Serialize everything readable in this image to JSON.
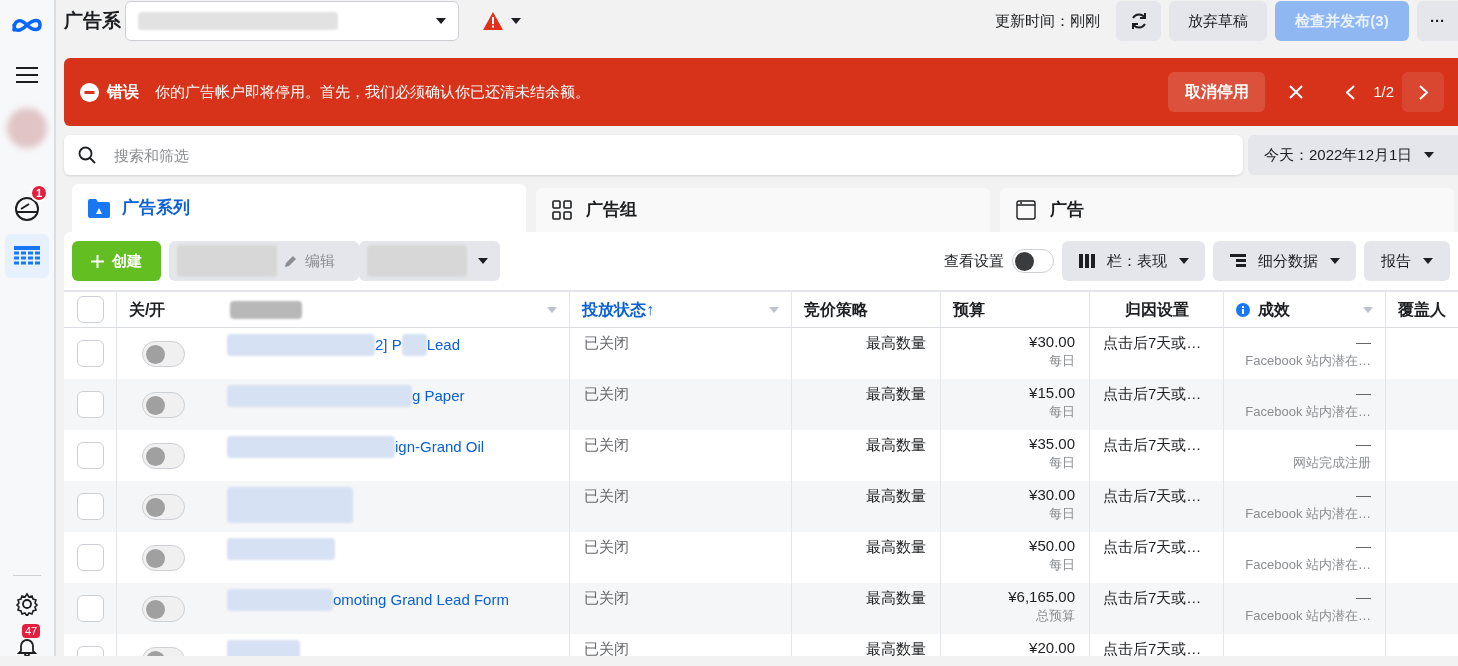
{
  "top_bar": {
    "title": "广告系",
    "updated": "更新时间：刚刚",
    "buttons": [
      {
        "label": "放弃草稿",
        "disabled": false
      },
      {
        "label": "检查并发布(3)",
        "disabled": true
      }
    ],
    "more": "···"
  },
  "sidebar": {
    "alerts_badge": "1",
    "notifications_badge": "47"
  },
  "banner": {
    "label": "错误",
    "message": "你的广告帐户即将停用。首先，我们必须确认你已还清未结余额。",
    "action": "取消停用",
    "pager": "1/2"
  },
  "search": {
    "placeholder": "搜索和筛选"
  },
  "date_button": "今天：2022年12月1日",
  "tabs": [
    {
      "label": "广告系列",
      "selected": true
    },
    {
      "label": "广告组",
      "selected": false
    },
    {
      "label": "广告",
      "selected": false
    }
  ],
  "toolbar": {
    "create": "创建",
    "edit": "编辑",
    "view_settings": {
      "label": "查看设置",
      "on": false
    },
    "buttons": [
      {
        "label": "栏：表现"
      },
      {
        "label": "细分数据"
      },
      {
        "label": "报告"
      }
    ]
  },
  "table": {
    "all_checked": false,
    "columns": [
      {
        "label": "关/开"
      },
      {
        "menu": true
      },
      {
        "label": "投放状态↑",
        "sorted": true,
        "menu": true
      },
      {
        "label": "竞价策略"
      },
      {
        "label": "预算"
      },
      {
        "label": "归因设置"
      },
      {
        "label": "成效",
        "info": true,
        "menu": true
      },
      {
        "label": "覆盖人"
      }
    ],
    "rows": [
      {
        "checked": false,
        "on": false,
        "name_parts": [
          "2] P",
          "Lead"
        ],
        "status": "已关闭",
        "bid": "最高数量",
        "budget": "¥30.00",
        "budget_type": "每日",
        "attribution": "点击后7天或…",
        "result": "—",
        "result_type": "Facebook 站内潜在…"
      },
      {
        "checked": false,
        "on": false,
        "name_parts": [
          "g Paper"
        ],
        "status": "已关闭",
        "bid": "最高数量",
        "budget": "¥15.00",
        "budget_type": "每日",
        "attribution": "点击后7天或…",
        "result": "—",
        "result_type": "Facebook 站内潜在…"
      },
      {
        "checked": false,
        "on": false,
        "name_parts": [
          "ign-Grand Oil"
        ],
        "status": "已关闭",
        "bid": "最高数量",
        "budget": "¥35.00",
        "budget_type": "每日",
        "attribution": "点击后7天或…",
        "result": "—",
        "result_type": "网站完成注册"
      },
      {
        "checked": false,
        "on": false,
        "name_parts": [],
        "status": "已关闭",
        "bid": "最高数量",
        "budget": "¥30.00",
        "budget_type": "每日",
        "attribution": "点击后7天或…",
        "result": "—",
        "result_type": "Facebook 站内潜在…"
      },
      {
        "checked": false,
        "on": false,
        "name_parts": [],
        "status": "已关闭",
        "bid": "最高数量",
        "budget": "¥50.00",
        "budget_type": "每日",
        "attribution": "点击后7天或…",
        "result": "—",
        "result_type": "Facebook 站内潜在…"
      },
      {
        "checked": false,
        "on": false,
        "name_parts": [
          "omoting Grand Lead Form"
        ],
        "status": "已关闭",
        "bid": "最高数量",
        "budget": "¥6,165.00",
        "budget_type": "总预算",
        "attribution": "点击后7天或…",
        "result": "—",
        "result_type": "Facebook 站内潜在…"
      },
      {
        "checked": false,
        "on": false,
        "name_parts": [],
        "status": "已关闭",
        "bid": "最高数量",
        "budget": "¥20.00",
        "attribution": "点击后7天或…"
      }
    ]
  }
}
